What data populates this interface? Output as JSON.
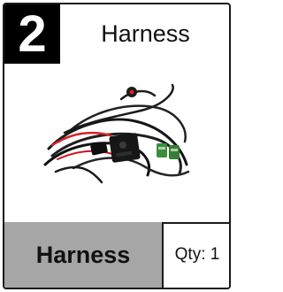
{
  "step_number": "2",
  "title": "Harness",
  "image": {
    "subject": "wiring-harness-photo"
  },
  "footer": {
    "name": "Harness",
    "quantity": "Qty: 1"
  },
  "colors": {
    "badge": "#000000",
    "footer_bg": "#a6a6a6",
    "border": "#1a1a1a",
    "wire_accent": "#d71f26",
    "connector": "#3c8d3a"
  }
}
